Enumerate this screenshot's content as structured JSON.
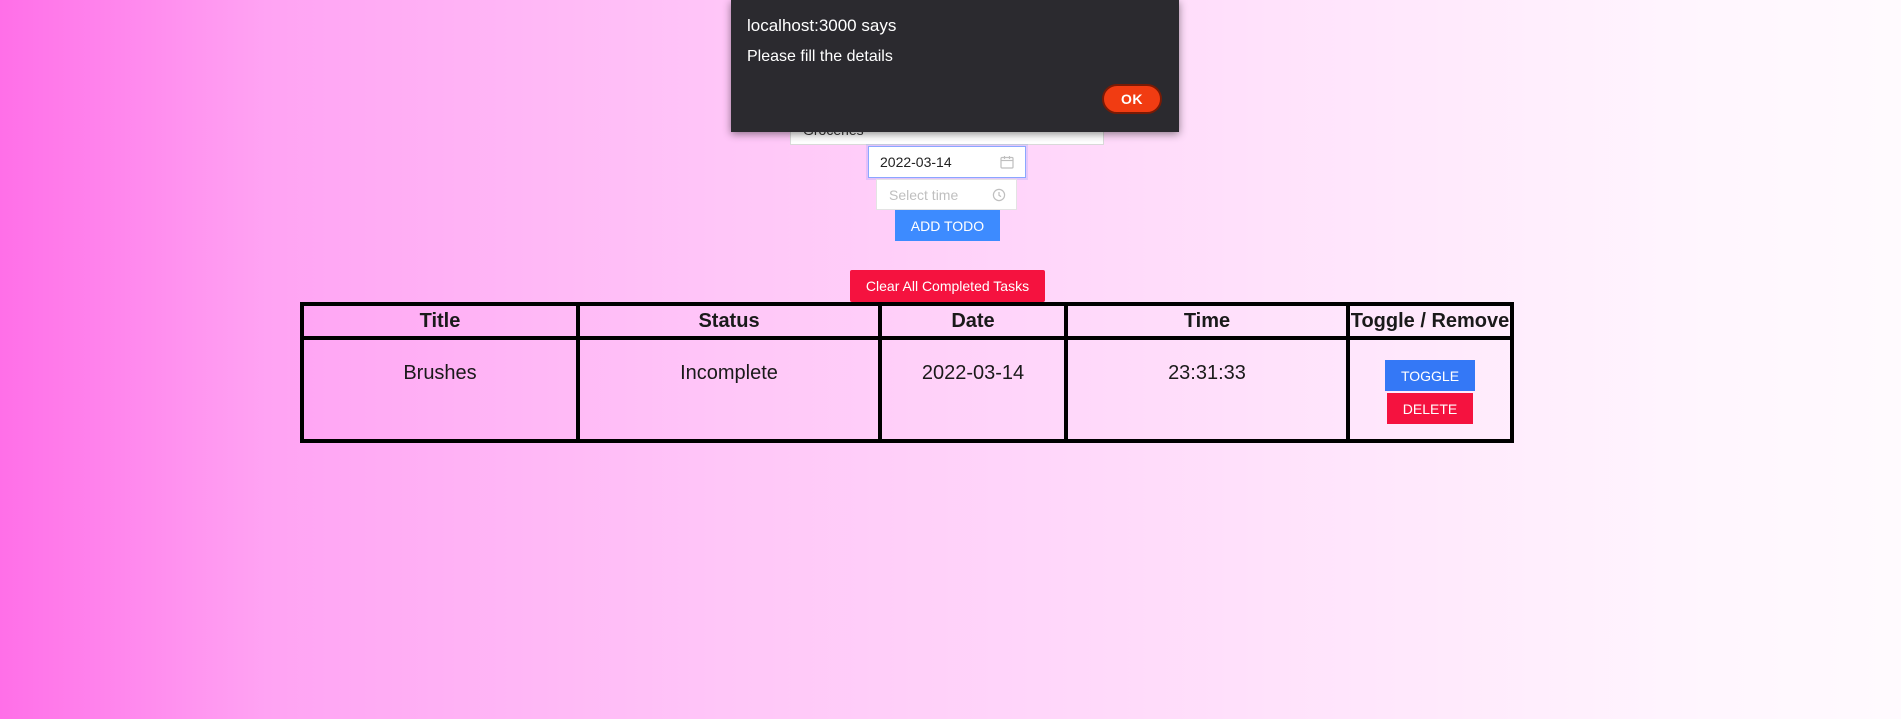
{
  "form": {
    "title_value": "Groceries",
    "date_value": "2022-03-14",
    "time_placeholder": "Select time",
    "add_label": "ADD TODO"
  },
  "clear_label": "Clear All Completed Tasks",
  "table": {
    "headers": [
      "Title",
      "Status",
      "Date",
      "Time",
      "Toggle / Remove"
    ],
    "rows": [
      {
        "title": "Brushes",
        "status": "Incomplete",
        "date": "2022-03-14",
        "time": "23:31:33",
        "toggle_label": "TOGGLE",
        "delete_label": "DELETE"
      }
    ]
  },
  "alert": {
    "title": "localhost:3000 says",
    "message": "Please fill the details",
    "ok_label": "OK"
  },
  "colors": {
    "primary": "#3d8bff",
    "danger": "#f5123f",
    "dialog_bg": "#2b2a2f",
    "dialog_ok": "#f13c12"
  },
  "icons": {
    "date_picker": "calendar-icon",
    "time_picker": "clock-icon"
  }
}
